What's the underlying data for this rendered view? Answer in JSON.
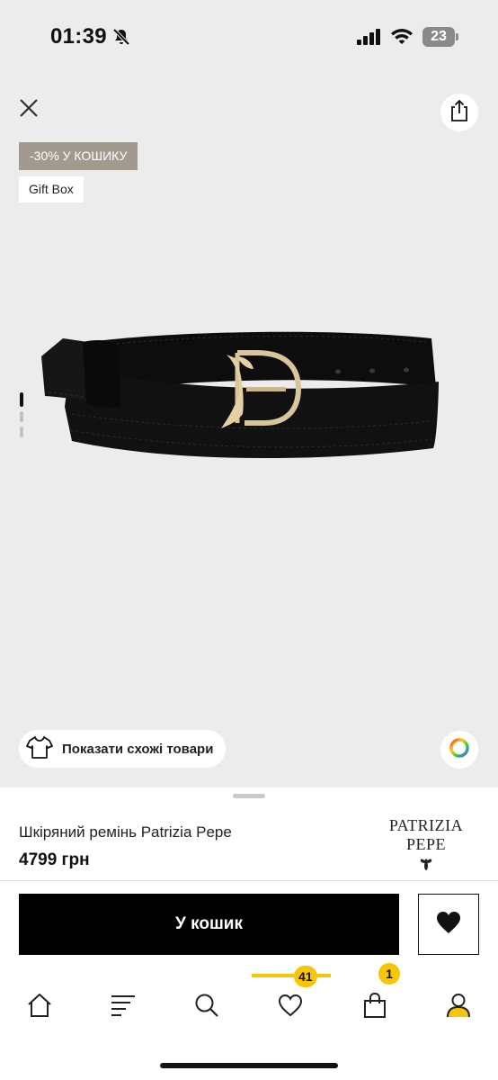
{
  "status_bar": {
    "time": "01:39",
    "battery": "23"
  },
  "product": {
    "badges": {
      "discount": "-30% У КОШИКУ",
      "gift": "Gift Box"
    },
    "similar_label": "Показати схожі товари",
    "name": "Шкіряний ремінь Patrizia Pepe",
    "price": "4799 грн",
    "brand": "PATRIZIA PEPE",
    "gallery_pages": 3,
    "gallery_active": 1
  },
  "actions": {
    "cart_label": "У кошик"
  },
  "nav": {
    "items": [
      {
        "icon": "home-icon"
      },
      {
        "icon": "menu-icon"
      },
      {
        "icon": "search-icon"
      },
      {
        "icon": "heart-icon",
        "badge": "41",
        "active": true
      },
      {
        "icon": "bag-icon",
        "badge": "1"
      },
      {
        "icon": "profile-icon"
      }
    ]
  },
  "colors": {
    "accent": "#f7c600",
    "discount_badge": "#a39a8f",
    "hero_background": "#ececec"
  }
}
